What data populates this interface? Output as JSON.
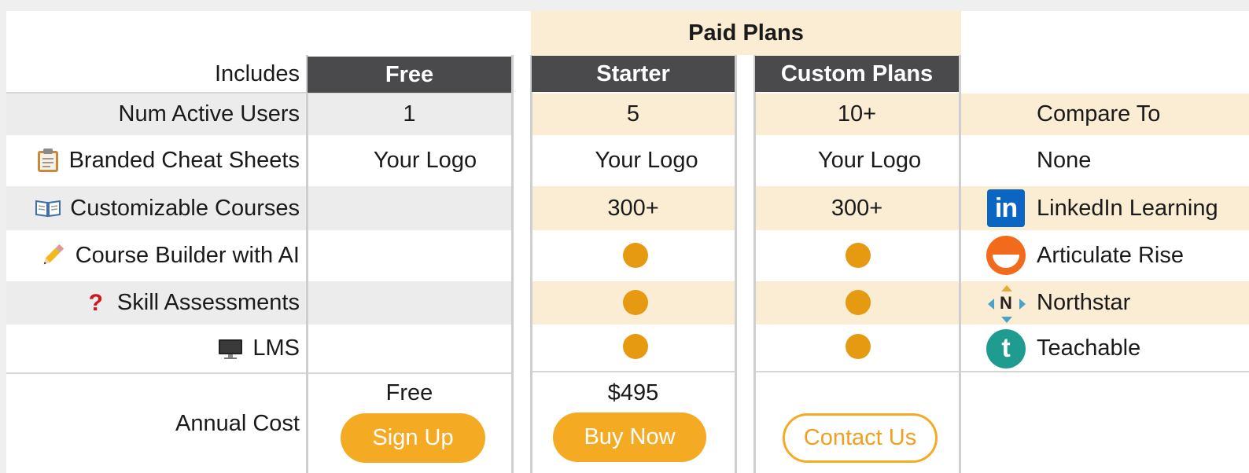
{
  "header": {
    "paid_plans": "Paid Plans",
    "includes": "Includes",
    "compare_to": "Compare To"
  },
  "plans": [
    {
      "name": "Free",
      "users": "1",
      "cheat_sheets": "Your Logo",
      "courses": "",
      "price": "Free",
      "button": "Sign Up"
    },
    {
      "name": "Starter",
      "users": "5",
      "cheat_sheets": "Your Logo",
      "courses": "300+",
      "price": "$495",
      "button": "Buy Now"
    },
    {
      "name": "Custom Plans",
      "users": "10+",
      "cheat_sheets": "Your Logo",
      "courses": "300+",
      "price": "",
      "button": "Contact Us"
    }
  ],
  "features": [
    {
      "label": "Num Active Users",
      "icon": ""
    },
    {
      "label": "Branded Cheat Sheets",
      "icon": "clipboard-icon"
    },
    {
      "label": "Customizable Courses",
      "icon": "open-book-icon"
    },
    {
      "label": "Course Builder with AI",
      "icon": "pencil-icon"
    },
    {
      "label": "Skill Assessments",
      "icon": "question-mark-icon"
    },
    {
      "label": "LMS",
      "icon": "desktop-computer-icon"
    }
  ],
  "annual_cost_label": "Annual Cost",
  "competitors": [
    {
      "label": "None",
      "icon": ""
    },
    {
      "label": "LinkedIn Learning",
      "icon": "linkedin-icon"
    },
    {
      "label": "Articulate Rise",
      "icon": "articulate-icon"
    },
    {
      "label": "Northstar",
      "icon": "northstar-icon"
    },
    {
      "label": "Teachable",
      "icon": "teachable-icon"
    }
  ],
  "icon_glyphs": {
    "linkedin": "in",
    "northstar": "N",
    "teachable": "t"
  },
  "colors": {
    "header_dark": "#4a4a4c",
    "cream": "#fbecd4",
    "accent_orange": "#f5aa24",
    "dot_orange": "#e69a12",
    "linkedin_blue": "#0a66c2",
    "articulate_orange": "#f26a1b",
    "teachable_teal": "#1f9c8f"
  }
}
